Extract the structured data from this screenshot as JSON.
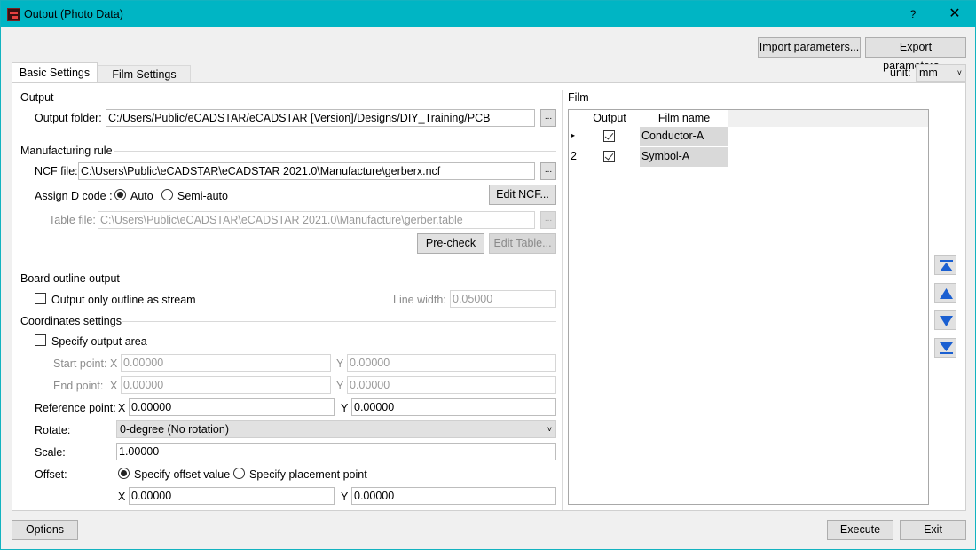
{
  "window": {
    "title": "Output (Photo Data)",
    "help": "?",
    "close": "✕"
  },
  "toolbar": {
    "import": "Import parameters...",
    "export": "Export parameters...",
    "unit_label": "unit:",
    "unit_value": "mm"
  },
  "tabs": [
    {
      "label": "Basic Settings",
      "active": true
    },
    {
      "label": "Film Settings",
      "active": false
    }
  ],
  "output": {
    "section": "Output",
    "folder_label": "Output folder:",
    "folder_value": "C:/Users/Public/eCADSTAR/eCADSTAR [Version]/Designs/DIY_Training/PCB"
  },
  "manufacturing": {
    "section": "Manufacturing rule",
    "ncf_label": "NCF file:",
    "ncf_value": "C:\\Users\\Public\\eCADSTAR\\eCADSTAR 2021.0\\Manufacture\\gerberx.ncf",
    "dcode_label": "Assign D code :",
    "auto": "Auto",
    "semi_auto": "Semi-auto",
    "edit_ncf": "Edit NCF...",
    "table_label": "Table file:",
    "table_value": "C:\\Users\\Public\\eCADSTAR\\eCADSTAR 2021.0\\Manufacture\\gerber.table",
    "precheck": "Pre-check",
    "edit_table": "Edit Table..."
  },
  "board_outline": {
    "section": "Board outline output",
    "stream_label": "Output only outline as stream",
    "line_width_label": "Line width:",
    "line_width_value": "0.05000"
  },
  "coords": {
    "section": "Coordinates settings",
    "specify_area": "Specify output area",
    "start_label": "Start point:",
    "end_label": "End point:",
    "x": "X",
    "y": "Y",
    "start_x": "0.00000",
    "start_y": "0.00000",
    "end_x": "0.00000",
    "end_y": "0.00000",
    "ref_label": "Reference point:",
    "ref_x": "0.00000",
    "ref_y": "0.00000",
    "rotate_label": "Rotate:",
    "rotate_value": "0-degree (No rotation)",
    "scale_label": "Scale:",
    "scale_value": "1.00000",
    "offset_label": "Offset:",
    "offset_value_opt": "Specify offset value",
    "placement_opt": "Specify placement point",
    "offset_x": "0.00000",
    "offset_y": "0.00000"
  },
  "film": {
    "section": "Film",
    "col_output": "Output",
    "col_name": "Film name",
    "rows": [
      {
        "marker": "▸",
        "output": true,
        "name": "Conductor-A"
      },
      {
        "marker": "2",
        "output": true,
        "name": "Symbol-A"
      }
    ]
  },
  "footer": {
    "options": "Options",
    "execute": "Execute",
    "exit": "Exit"
  },
  "colors": {
    "titlebar": "#00b5c4",
    "move_arrow": "#1a5fd1"
  }
}
